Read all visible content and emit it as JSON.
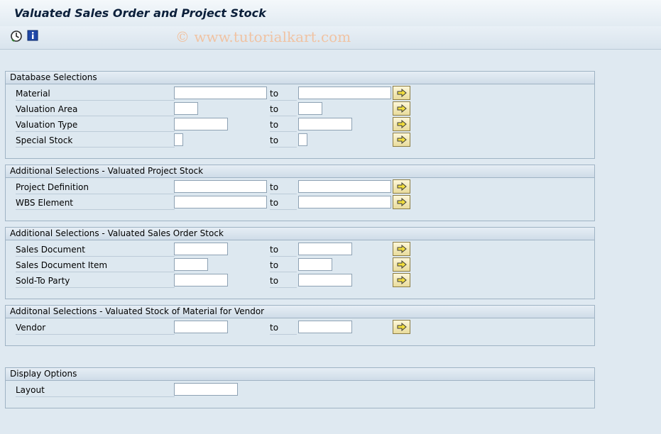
{
  "window": {
    "title": "Valuated Sales Order and Project Stock"
  },
  "toolbar": {
    "execute_icon": "execute-clock-icon",
    "info_icon": "info-icon"
  },
  "watermark": "© www.tutorialkart.com",
  "common": {
    "to_label": "to",
    "multiple_selection_icon": "arrow-right-icon"
  },
  "groups": [
    {
      "title": "Database Selections",
      "rows": [
        {
          "label": "Material",
          "from": "",
          "to": ""
        },
        {
          "label": "Valuation Area",
          "from": "",
          "to": ""
        },
        {
          "label": "Valuation Type",
          "from": "",
          "to": ""
        },
        {
          "label": "Special Stock",
          "from": "",
          "to": ""
        }
      ]
    },
    {
      "title": "Additional Selections - Valuated Project Stock",
      "rows": [
        {
          "label": "Project Definition",
          "from": "",
          "to": ""
        },
        {
          "label": "WBS Element",
          "from": "",
          "to": ""
        }
      ]
    },
    {
      "title": "Additional Selections - Valuated Sales Order Stock",
      "rows": [
        {
          "label": "Sales Document",
          "from": "",
          "to": ""
        },
        {
          "label": "Sales Document Item",
          "from": "",
          "to": ""
        },
        {
          "label": "Sold-To Party",
          "from": "",
          "to": ""
        }
      ]
    },
    {
      "title": "Additonal Selections - Valuated Stock of Material for Vendor",
      "rows": [
        {
          "label": "Vendor",
          "from": "",
          "to": ""
        }
      ]
    },
    {
      "title": "Display Options",
      "rows": [
        {
          "label": "Layout",
          "value": ""
        }
      ]
    }
  ]
}
